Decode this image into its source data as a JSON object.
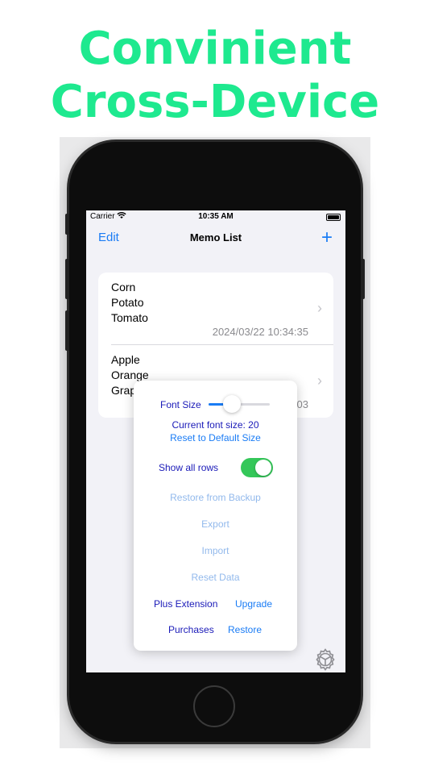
{
  "headline": {
    "line1": "Convinient",
    "line2": "Cross-Device"
  },
  "status_bar": {
    "carrier": "Carrier",
    "time": "10:35 AM"
  },
  "nav": {
    "edit_label": "Edit",
    "title": "Memo List",
    "add_label": "+"
  },
  "memos": [
    {
      "lines": [
        "Corn",
        "Potato",
        "Tomato"
      ],
      "date": "2024/03/22 10:34:35"
    },
    {
      "lines": [
        "Apple",
        "Orange",
        "Grap"
      ],
      "date": "03"
    }
  ],
  "settings_popup": {
    "font_size_label": "Font Size",
    "font_size_slider_fraction": 0.38,
    "current_font_size": "Current font size: 20",
    "reset_default": "Reset to Default Size",
    "show_all_rows_label": "Show all rows",
    "show_all_rows_on": true,
    "restore_backup": "Restore from Backup",
    "export": "Export",
    "import": "Import",
    "reset_data": "Reset Data",
    "plus_extension": "Plus Extension",
    "upgrade": "Upgrade",
    "purchases": "Purchases",
    "restore": "Restore"
  },
  "icons": {
    "settings": "gear-icon",
    "chevron": "chevron-right-icon",
    "wifi": "wifi-icon",
    "battery": "battery-icon"
  },
  "colors": {
    "headline": "#1ee98f",
    "accent": "#1a7cf5",
    "toggle_on": "#34c759",
    "popup_text": "#1a1ab8"
  }
}
